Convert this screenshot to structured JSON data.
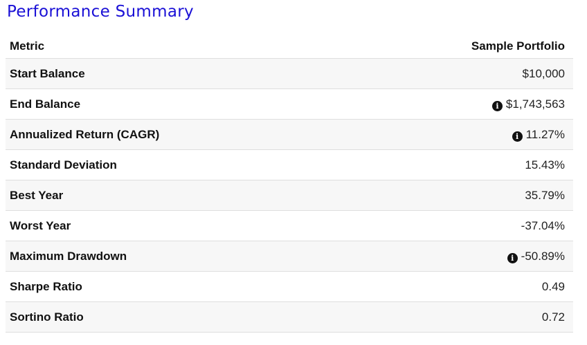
{
  "title": "Performance Summary",
  "table": {
    "headers": [
      "Metric",
      "Sample Portfolio"
    ],
    "rows": [
      {
        "metric": "Start Balance",
        "value": "$10,000",
        "info": false
      },
      {
        "metric": "End Balance",
        "value": "$1,743,563",
        "info": true
      },
      {
        "metric": "Annualized Return (CAGR)",
        "value": "11.27%",
        "info": true
      },
      {
        "metric": "Standard Deviation",
        "value": "15.43%",
        "info": false
      },
      {
        "metric": "Best Year",
        "value": "35.79%",
        "info": false
      },
      {
        "metric": "Worst Year",
        "value": "-37.04%",
        "info": false
      },
      {
        "metric": "Maximum Drawdown",
        "value": "-50.89%",
        "info": true
      },
      {
        "metric": "Sharpe Ratio",
        "value": "0.49",
        "info": false
      },
      {
        "metric": "Sortino Ratio",
        "value": "0.72",
        "info": false
      }
    ]
  },
  "icons": {
    "info": "info-circle-icon"
  },
  "colors": {
    "title": "#1a10d6",
    "row_stripe": "#f7f7f7",
    "row_border": "#dedede",
    "info_icon": "#111111"
  }
}
